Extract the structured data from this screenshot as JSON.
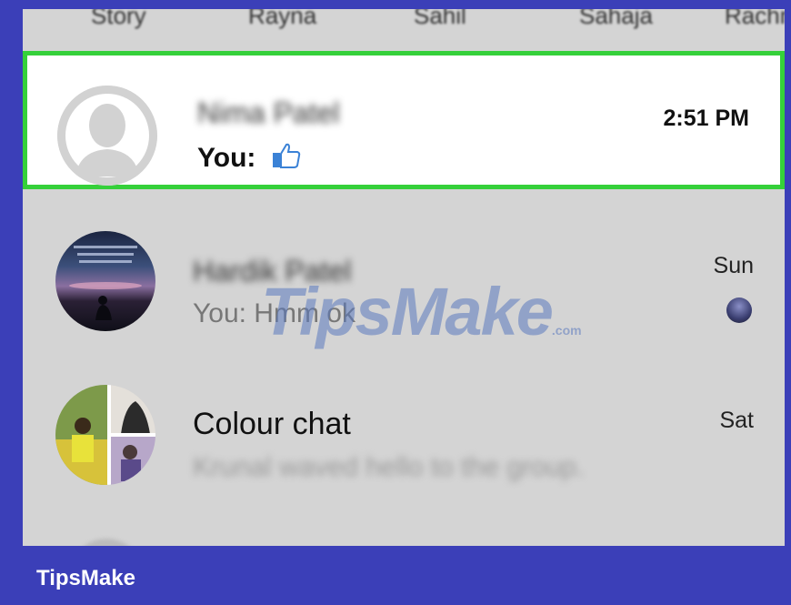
{
  "stories": [
    {
      "label": "Story"
    },
    {
      "label": "Rayna"
    },
    {
      "label": "Sahil"
    },
    {
      "label": "Sahaja"
    },
    {
      "label": "Rachna"
    }
  ],
  "conversations": [
    {
      "name": "Nima Patel",
      "preview": "You:",
      "time": "2:51 PM",
      "reaction": "like-icon"
    },
    {
      "name": "Hardik Patel",
      "preview": "You: Hmm ok",
      "time": "Sun"
    },
    {
      "name": "Colour chat",
      "preview": "Krunal waved hello to the group.",
      "time": "Sat"
    }
  ],
  "watermark": {
    "text": "TipsMake",
    "suffix": ".com"
  },
  "footer": {
    "brand": "TipsMake"
  },
  "colors": {
    "highlight_border": "#35d03a",
    "frame": "#3b3fb8",
    "like_blue": "#3b82d6"
  }
}
